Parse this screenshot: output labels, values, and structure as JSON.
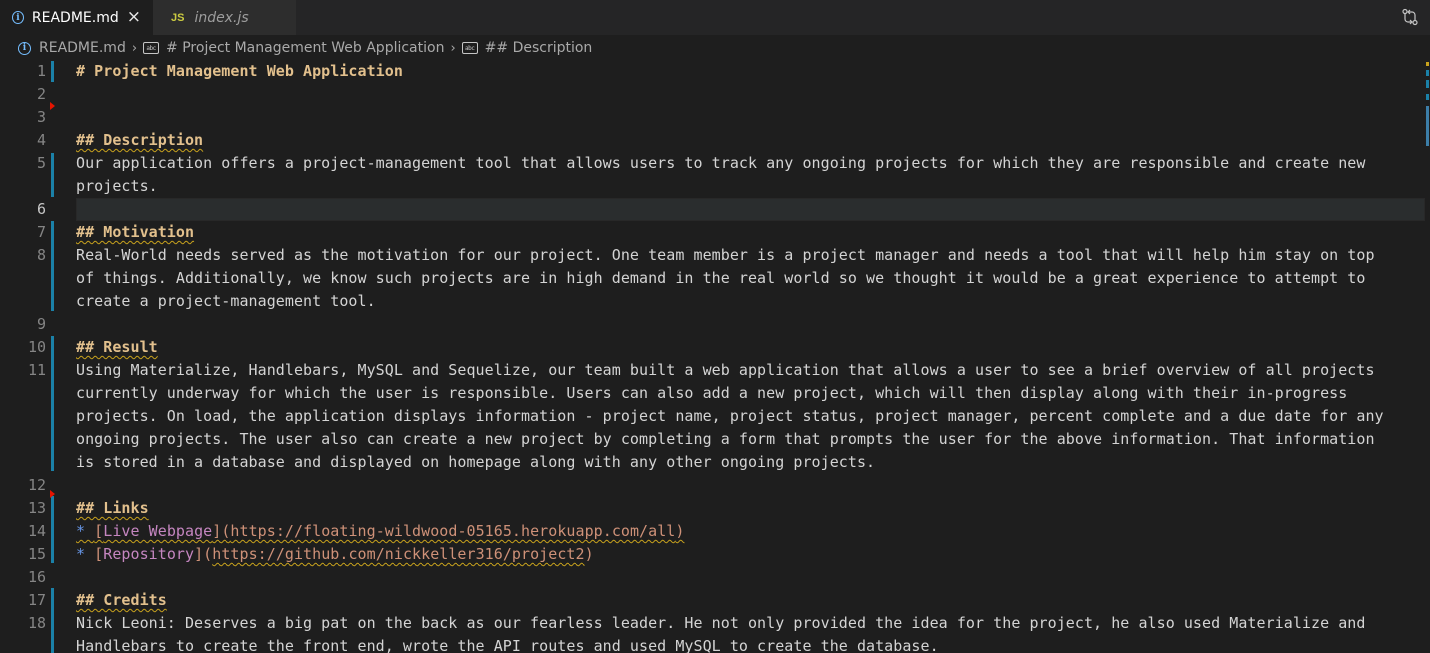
{
  "tabs": [
    {
      "label": "README.md",
      "active": true,
      "icon": "info-icon"
    },
    {
      "label": "index.js",
      "active": false,
      "icon": "js-icon",
      "icon_text": "JS"
    }
  ],
  "breadcrumb": {
    "file": "README.md",
    "h1": "# Project Management Web Application",
    "h2": "## Description"
  },
  "editor": {
    "current_line": 6,
    "lines": [
      {
        "n": "1",
        "text": "# Project Management Web Application"
      },
      {
        "n": "2",
        "text": ""
      },
      {
        "n": "3",
        "text": ""
      },
      {
        "n": "4",
        "text": "## Description"
      },
      {
        "n": "5",
        "text": "Our application offers a project-management tool that allows users to track any ongoing projects for which they are responsible and create new",
        "wrap": [
          "projects."
        ]
      },
      {
        "n": "6",
        "text": ""
      },
      {
        "n": "7",
        "text": "## Motivation"
      },
      {
        "n": "8",
        "text": "Real-World needs served as the motivation for our project. One team member is a project manager and needs a tool that will help him stay on top",
        "wrap": [
          "of things. Additionally, we know such projects are in high demand in the real world so we thought it would be a great experience to attempt to",
          "create a project-management tool."
        ]
      },
      {
        "n": "9",
        "text": ""
      },
      {
        "n": "10",
        "text": "## Result"
      },
      {
        "n": "11",
        "text": "Using Materialize, Handlebars, MySQL and Sequelize, our team built a web application that allows a user to see a brief overview of all projects",
        "wrap": [
          "currently underway for which the user is responsible. Users can also add a new project, which will then display along with their in-progress",
          "projects. On load, the application displays information - project name, project status, project manager, percent complete and a due date for any",
          "ongoing projects. The user also can create a new project by completing a form that prompts the user for the above information. That information",
          "is stored in a database and displayed on homepage along with any other ongoing projects."
        ]
      },
      {
        "n": "12",
        "text": ""
      },
      {
        "n": "13",
        "text": "## Links"
      },
      {
        "n": "14",
        "bullet": "* ",
        "link_text": "Live Webpage",
        "url": "https://floating-wildwood-05165.herokuapp.com/all"
      },
      {
        "n": "15",
        "bullet": "* ",
        "link_text": "Repository",
        "url": "https://github.com/nickkeller316/project2"
      },
      {
        "n": "16",
        "text": ""
      },
      {
        "n": "17",
        "text": "## Credits"
      },
      {
        "n": "18",
        "text": "Nick Leoni: Deserves a big pat on the back as our fearless leader. He not only provided the idea for the project, he also used Materialize and",
        "wrap": [
          "Handlebars to create the front end, wrote the API routes and used MySQL to create the database."
        ]
      }
    ]
  },
  "colors": {
    "heading": "#e2c08d",
    "link_text": "#c586c0",
    "url": "#ce9178",
    "bullet": "#6796e6",
    "gutter_mod": "#1b81a8"
  }
}
